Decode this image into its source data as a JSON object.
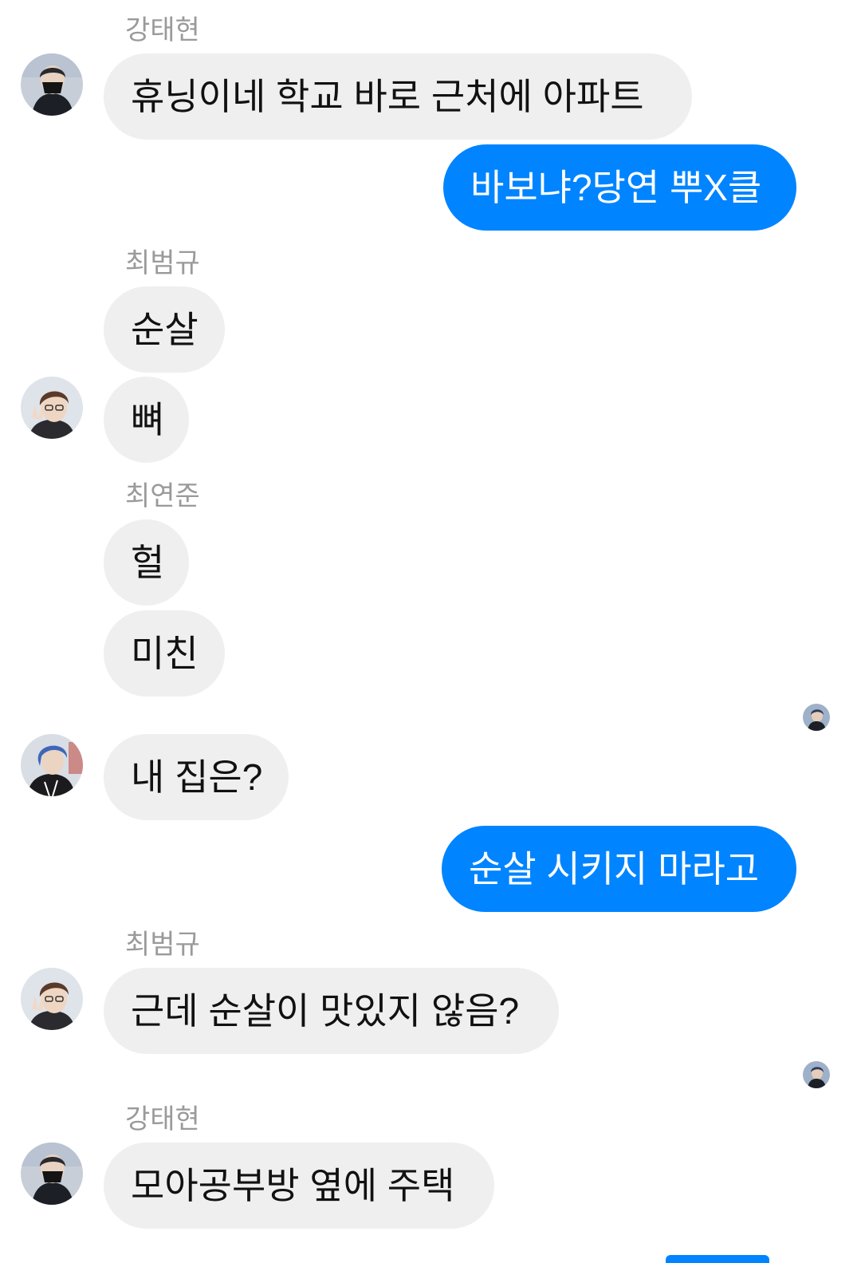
{
  "colors": {
    "incoming_bubble": "#efefef",
    "outgoing_bubble": "#0084ff",
    "sender_name": "#9a9a9a"
  },
  "messages": [
    {
      "sender": "강태현",
      "direction": "in",
      "text": "휴닝이네 학교 바로 근처에 아파트",
      "avatar": "person-black-mask-avatar"
    },
    {
      "direction": "out",
      "text": "바보냐?당연 뿌X클"
    },
    {
      "sender": "최범규",
      "direction": "in",
      "text": "순살"
    },
    {
      "direction": "in",
      "text": "뼈",
      "avatar": "person-v-sign-avatar"
    },
    {
      "sender": "최연준",
      "direction": "in",
      "text": "헐"
    },
    {
      "direction": "in",
      "text": "미친"
    },
    {
      "direction": "in",
      "text": "내 집은?",
      "avatar": "person-blue-hair-avatar"
    },
    {
      "direction": "out",
      "text": "순살 시키지 마라고"
    },
    {
      "sender": "최범규",
      "direction": "in",
      "text": "근데 순살이 맛있지 않음?",
      "avatar": "person-v-sign-avatar"
    },
    {
      "sender": "강태현",
      "direction": "in",
      "text": "모아공부방 옆에 주택",
      "avatar": "person-black-mask-avatar"
    }
  ],
  "read_receipts": [
    "read-receipt-avatar",
    "read-receipt-avatar"
  ]
}
